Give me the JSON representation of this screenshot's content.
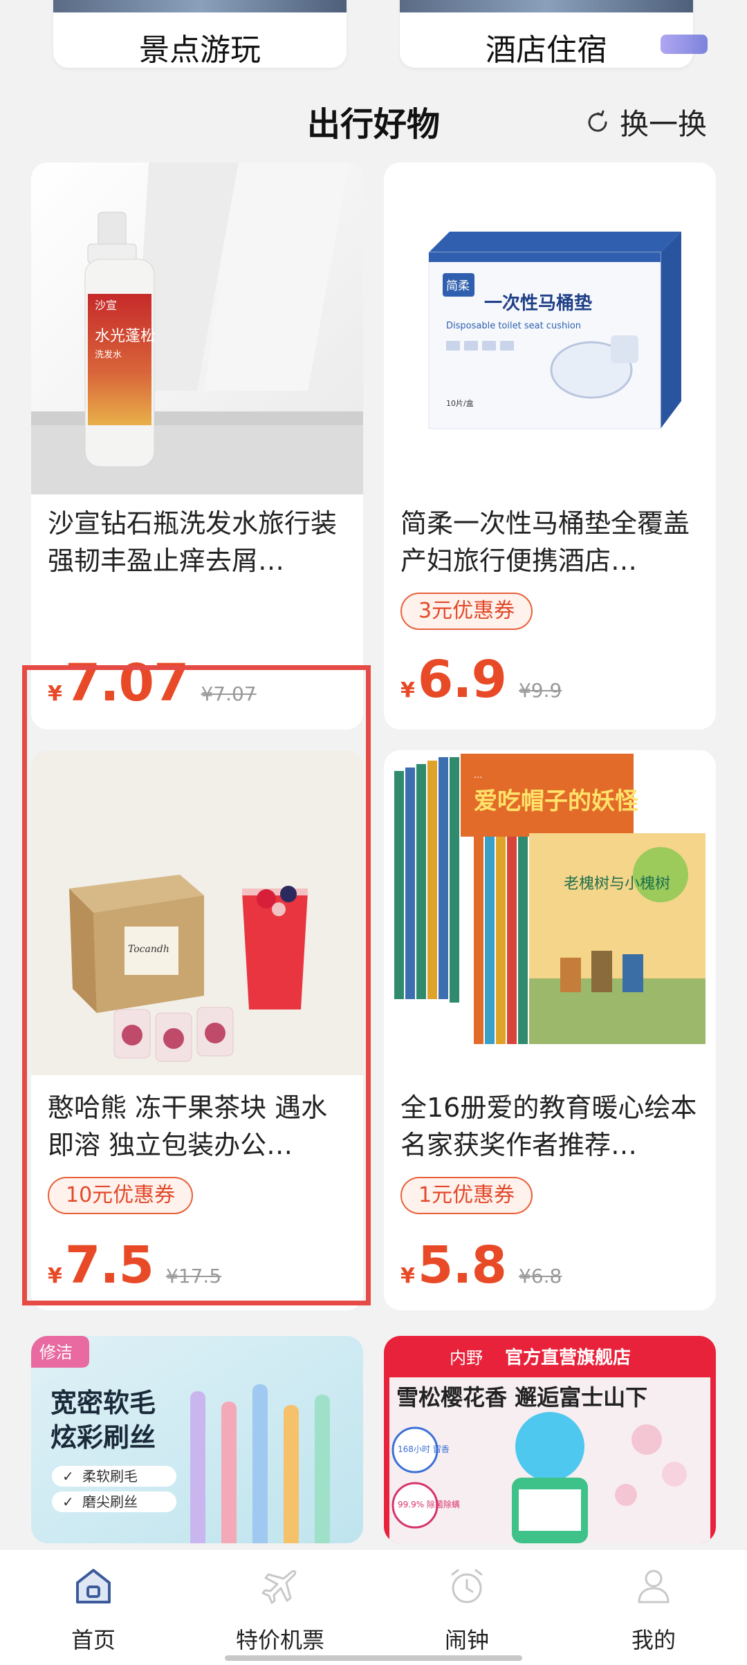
{
  "categories": [
    {
      "label": "景点游玩"
    },
    {
      "label": "酒店住宿"
    }
  ],
  "section": {
    "title": "出行好物",
    "refresh_icon": "refresh-icon",
    "refresh_label": "换一换"
  },
  "products": [
    {
      "title": "沙宣钻石瓶洗发水旅行装强韧丰盈止痒去屑…",
      "coupon": "",
      "currency": "¥",
      "price": "7.07",
      "original_price": "¥7.07",
      "image_text": {
        "brand": "沙宣",
        "name": "水光蓬松",
        "sub": "洗发水"
      }
    },
    {
      "title": "简柔一次性马桶垫全覆盖产妇旅行便携酒店…",
      "coupon": "3元优惠券",
      "currency": "¥",
      "price": "6.9",
      "original_price": "¥9.9",
      "image_text": {
        "brand": "简柔",
        "name": "一次性马桶垫",
        "sub": "Disposable toilet seat cushion",
        "count": "10片/盒"
      }
    },
    {
      "title": "憨哈熊 冻干果茶块 遇水即溶 独立包装办公…",
      "coupon": "10元优惠券",
      "currency": "¥",
      "price": "7.5",
      "original_price": "¥17.5",
      "image_text": {
        "brand": "Tocandh"
      }
    },
    {
      "title": "全16册爱的教育暖心绘本名家获奖作者推荐…",
      "coupon": "1元优惠券",
      "currency": "¥",
      "price": "5.8",
      "original_price": "¥6.8",
      "image_text": {
        "book1": "爱吃帽子的妖怪",
        "book2": "老槐树与小槐树"
      }
    },
    {
      "title": "",
      "image_text": {
        "tag": "修洁",
        "line1": "宽密软毛",
        "line2": "炫彩刷丝",
        "feat1": "柔软刷毛",
        "feat2": "磨尖刷丝"
      }
    },
    {
      "title": "",
      "image_text": {
        "brand": "内野",
        "shop": "官方直营旗舰店",
        "headline": "雪松樱花香 邂逅富士山下",
        "badge1": "168小时 留香",
        "badge2": "99.9% 除菌除螨"
      }
    }
  ],
  "nav": [
    {
      "label": "首页",
      "icon": "home-icon",
      "active": true
    },
    {
      "label": "特价机票",
      "icon": "airplane-icon",
      "active": false
    },
    {
      "label": "闹钟",
      "icon": "alarm-clock-icon",
      "active": false
    },
    {
      "label": "我的",
      "icon": "profile-icon",
      "active": false
    }
  ],
  "colors": {
    "accent": "#e84a27",
    "coupon_border": "#e8603a",
    "highlight": "#e64a45",
    "nav_active": "#3b5b9a"
  }
}
